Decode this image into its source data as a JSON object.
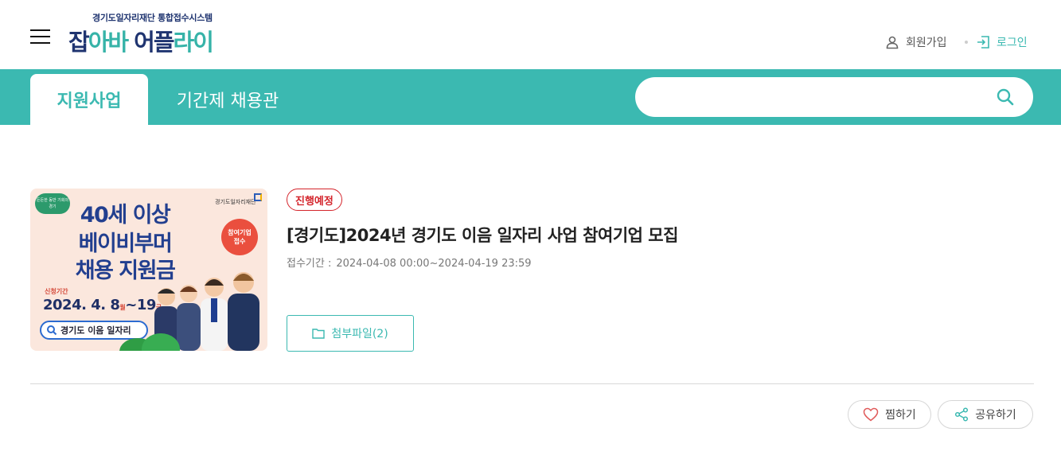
{
  "header": {
    "logo_sub": "경기도일자리재단 통합접수시스템",
    "logo_part1": "잡",
    "logo_part2": "아바",
    "logo_part3": "어플",
    "logo_part4": "라이",
    "join_label": "회원가입",
    "login_label": "로그인",
    "icons": {
      "menu": "hamburger-icon",
      "join": "user-icon",
      "login": "login-icon"
    }
  },
  "nav": {
    "tabs": [
      {
        "label": "지원사업",
        "active": true
      },
      {
        "label": "기간제 채용관",
        "active": false
      }
    ],
    "search": {
      "placeholder": "",
      "value": "",
      "icon": "search-icon"
    }
  },
  "post": {
    "status": "진행예정",
    "title": "[경기도]2024년 경기도 이음 일자리 사업 참여기업 모집",
    "period_label": "접수기간 :",
    "period_value": "2024-04-08 00:00~2024-04-19 23:59",
    "attach_label": "첨부파일(2)",
    "thumbnail": {
      "line1": "40세 이상",
      "line2": "베이비부머",
      "line3": "채용 지원금",
      "badge": "든든한 동반 기회의 경기",
      "org": "경기도일자리재단",
      "circle1": "참여기업",
      "circle2": "접수",
      "period_label": "신청기간",
      "date_main": "2024. 4. 8",
      "date_day1": "월",
      "date_mid": "~19",
      "date_day2": "금",
      "search_text": "경기도 이음 일자리"
    }
  },
  "actions": {
    "like_label": "찜하기",
    "share_label": "공유하기"
  },
  "colors": {
    "teal": "#3bb9b1",
    "navy": "#1f3470",
    "status_red": "#d4242b"
  }
}
